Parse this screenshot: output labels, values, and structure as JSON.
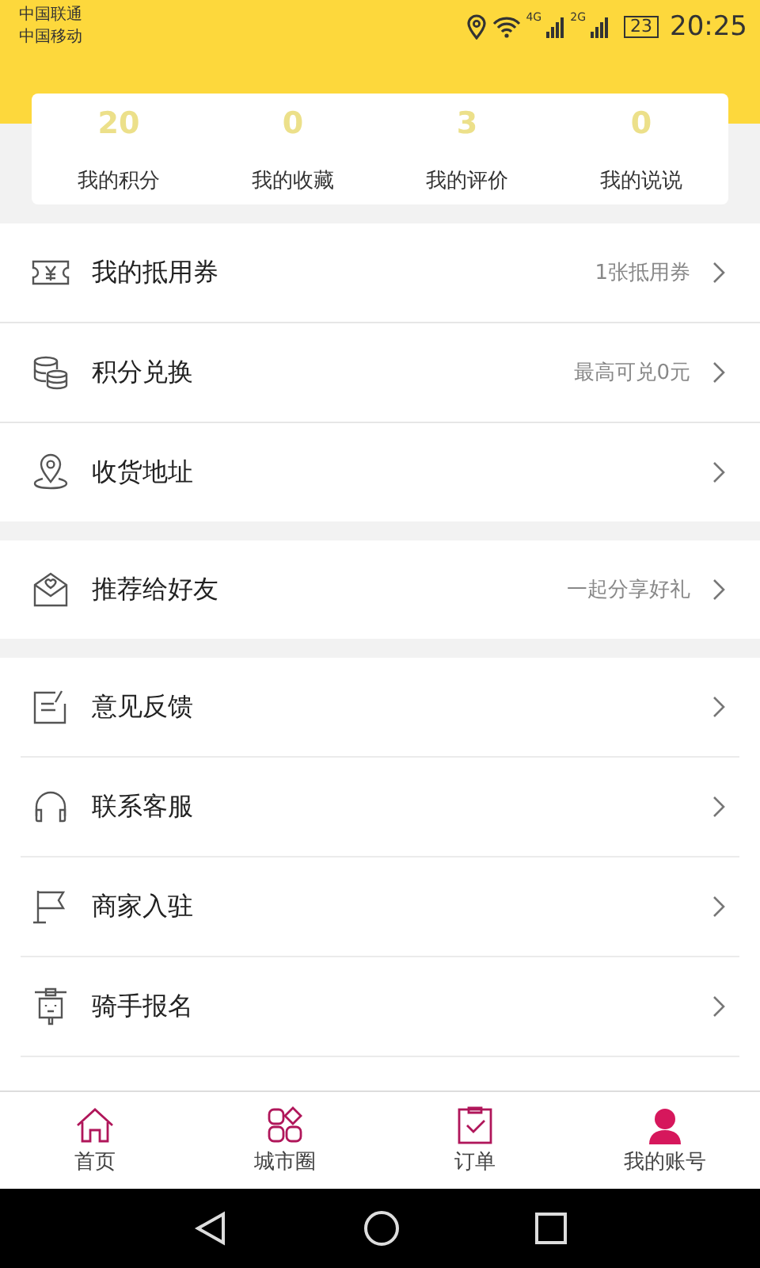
{
  "status_bar": {
    "carriers": [
      "中国联通",
      "中国移动"
    ],
    "network_1": "4G",
    "network_2": "2G",
    "battery": "23",
    "time": "20:25"
  },
  "stats": [
    {
      "value": "20",
      "label": "我的积分"
    },
    {
      "value": "0",
      "label": "我的收藏"
    },
    {
      "value": "3",
      "label": "我的评价"
    },
    {
      "value": "0",
      "label": "我的说说"
    }
  ],
  "menu_groups": [
    {
      "inset_dividers": false,
      "items": [
        {
          "kind": "coupon",
          "label": "我的抵用券",
          "detail": "1张抵用券"
        },
        {
          "kind": "coins",
          "label": "积分兑换",
          "detail": "最高可兑0元"
        },
        {
          "kind": "location",
          "label": "收货地址"
        }
      ]
    },
    {
      "inset_dividers": false,
      "items": [
        {
          "kind": "letter",
          "label": "推荐给好友",
          "detail": "一起分享好礼"
        }
      ]
    },
    {
      "inset_dividers": true,
      "items": [
        {
          "kind": "note",
          "label": "意见反馈"
        },
        {
          "kind": "headset",
          "label": "联系客服"
        },
        {
          "kind": "flag",
          "label": "商家入驻"
        },
        {
          "kind": "rider",
          "label": "骑手报名"
        }
      ]
    }
  ],
  "tabs": [
    {
      "kind": "home",
      "label": "首页",
      "selected": false
    },
    {
      "kind": "grid",
      "label": "城市圈",
      "selected": false
    },
    {
      "kind": "clipboard",
      "label": "订单",
      "selected": false
    },
    {
      "kind": "person",
      "label": "我的账号",
      "selected": true
    }
  ]
}
